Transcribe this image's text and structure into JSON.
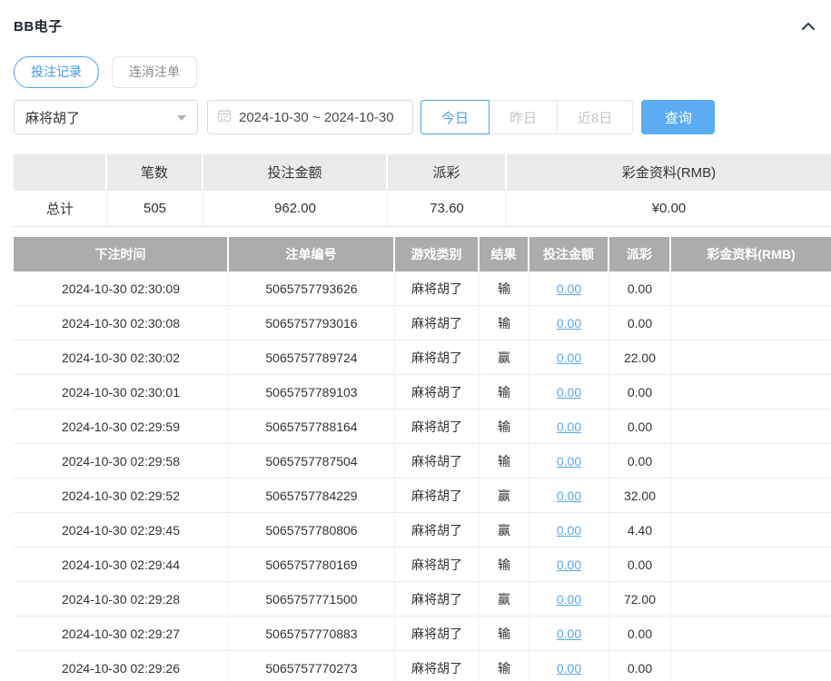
{
  "header": {
    "title": "BB电子",
    "collapse_icon": "chevron-up"
  },
  "tabs": [
    {
      "label": "投注记录",
      "active": true
    },
    {
      "label": "连消注单",
      "active": false
    }
  ],
  "filters": {
    "game_select": {
      "value": "麻将胡了",
      "icon": "caret-down"
    },
    "date_range": {
      "value": "2024-10-30 ~ 2024-10-30",
      "icon": "calendar"
    },
    "quick_ranges": [
      {
        "label": "今日",
        "active": true
      },
      {
        "label": "昨日",
        "active": false
      },
      {
        "label": "近8日",
        "active": false
      }
    ],
    "search_label": "查询"
  },
  "summary": {
    "headers": [
      "",
      "笔数",
      "投注金额",
      "派彩",
      "彩金资料(RMB)"
    ],
    "row": {
      "label": "总计",
      "count": "505",
      "bet_amount": "962.00",
      "payout": "73.60",
      "bonus": "¥0.00"
    }
  },
  "records": {
    "headers": [
      "下注时间",
      "注单编号",
      "游戏类别",
      "结果",
      "投注金额",
      "派彩",
      "彩金资料(RMB)"
    ],
    "rows": [
      {
        "time": "2024-10-30 02:30:09",
        "order_no": "5065757793626",
        "game": "麻将胡了",
        "result": "输",
        "bet": "0.00",
        "payout": "0.00",
        "bonus": ""
      },
      {
        "time": "2024-10-30 02:30:08",
        "order_no": "5065757793016",
        "game": "麻将胡了",
        "result": "输",
        "bet": "0.00",
        "payout": "0.00",
        "bonus": ""
      },
      {
        "time": "2024-10-30 02:30:02",
        "order_no": "5065757789724",
        "game": "麻将胡了",
        "result": "赢",
        "bet": "0.00",
        "payout": "22.00",
        "bonus": ""
      },
      {
        "time": "2024-10-30 02:30:01",
        "order_no": "5065757789103",
        "game": "麻将胡了",
        "result": "输",
        "bet": "0.00",
        "payout": "0.00",
        "bonus": ""
      },
      {
        "time": "2024-10-30 02:29:59",
        "order_no": "5065757788164",
        "game": "麻将胡了",
        "result": "输",
        "bet": "0.00",
        "payout": "0.00",
        "bonus": ""
      },
      {
        "time": "2024-10-30 02:29:58",
        "order_no": "5065757787504",
        "game": "麻将胡了",
        "result": "输",
        "bet": "0.00",
        "payout": "0.00",
        "bonus": ""
      },
      {
        "time": "2024-10-30 02:29:52",
        "order_no": "5065757784229",
        "game": "麻将胡了",
        "result": "赢",
        "bet": "0.00",
        "payout": "32.00",
        "bonus": ""
      },
      {
        "time": "2024-10-30 02:29:45",
        "order_no": "5065757780806",
        "game": "麻将胡了",
        "result": "赢",
        "bet": "0.00",
        "payout": "4.40",
        "bonus": ""
      },
      {
        "time": "2024-10-30 02:29:44",
        "order_no": "5065757780169",
        "game": "麻将胡了",
        "result": "输",
        "bet": "0.00",
        "payout": "0.00",
        "bonus": ""
      },
      {
        "time": "2024-10-30 02:29:28",
        "order_no": "5065757771500",
        "game": "麻将胡了",
        "result": "赢",
        "bet": "0.00",
        "payout": "72.00",
        "bonus": ""
      },
      {
        "time": "2024-10-30 02:29:27",
        "order_no": "5065757770883",
        "game": "麻将胡了",
        "result": "输",
        "bet": "0.00",
        "payout": "0.00",
        "bonus": ""
      },
      {
        "time": "2024-10-30 02:29:26",
        "order_no": "5065757770273",
        "game": "麻将胡了",
        "result": "输",
        "bet": "0.00",
        "payout": "0.00",
        "bonus": ""
      }
    ]
  },
  "colors": {
    "accent_blue": "#4da3ef",
    "search_button_fill": "#5bacf2",
    "link_blue": "#58a7ee",
    "records_header_bg": "#acacac",
    "summary_header_bg": "#ebebeb"
  }
}
